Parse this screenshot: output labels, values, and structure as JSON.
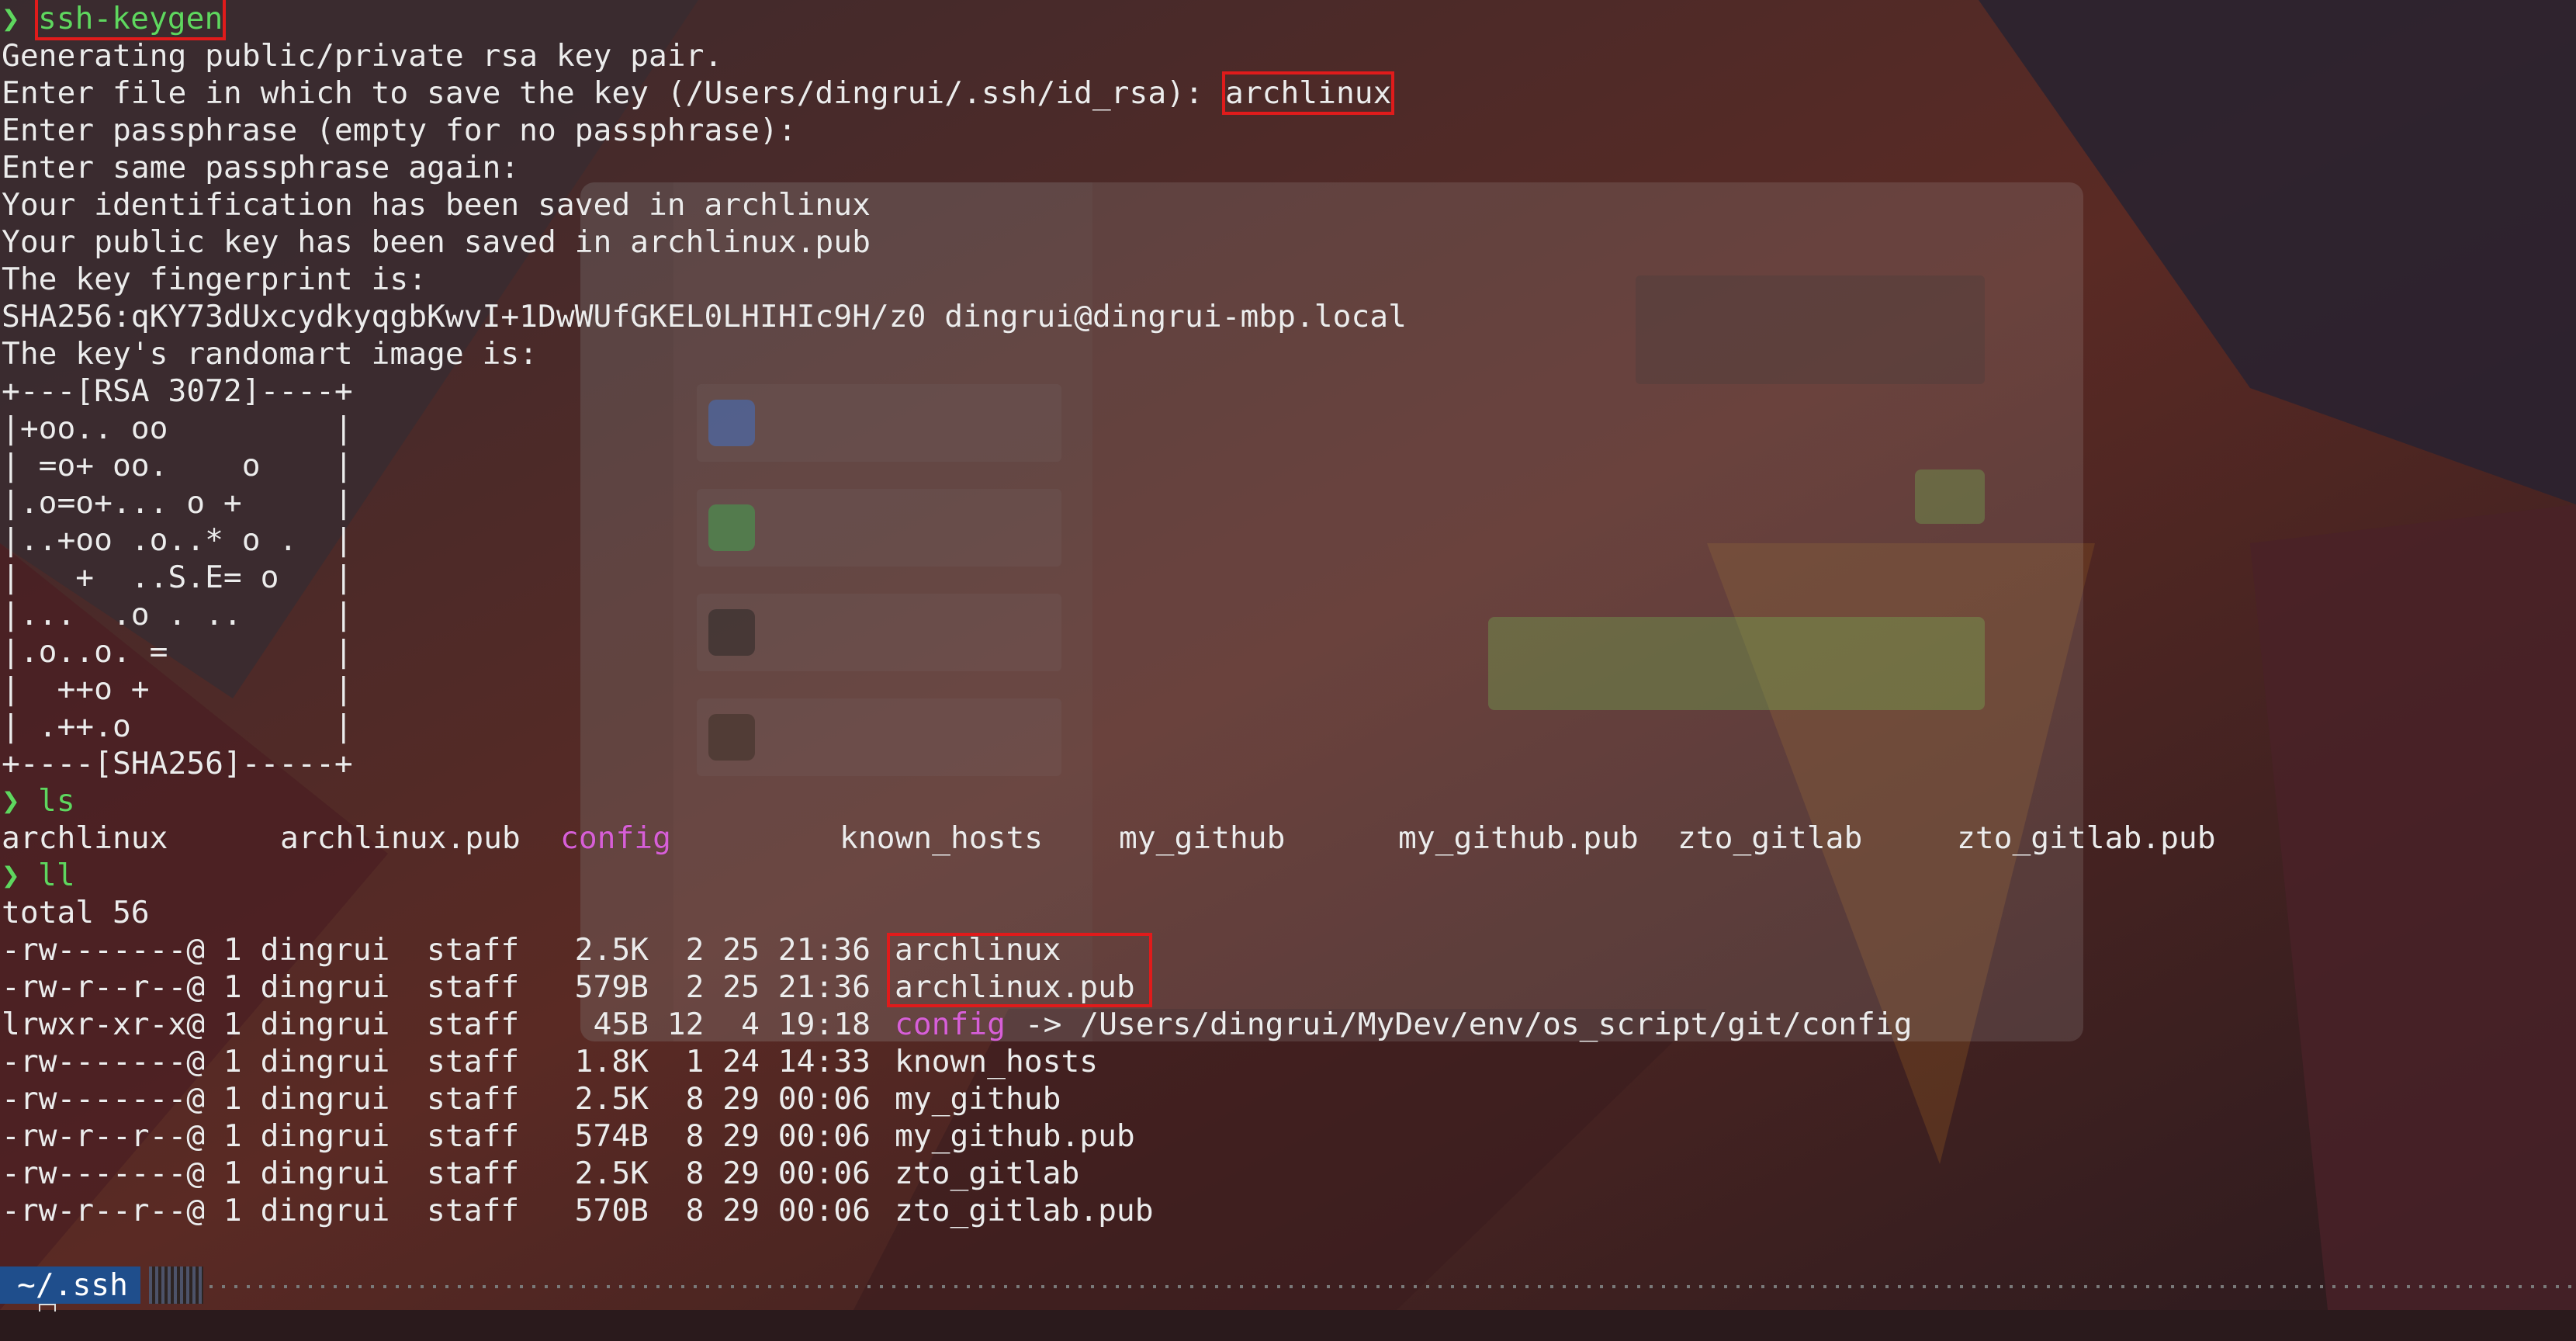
{
  "colors": {
    "prompt": "#5fd75f",
    "symlink": "#d75fd7",
    "highlight_box": "#e01b1b",
    "status_bg": "#1f4e8c",
    "text": "#ececec"
  },
  "prompt_glyph": "❯",
  "keygen": {
    "command": "ssh-keygen",
    "generating": "Generating public/private rsa key pair.",
    "enter_file_prompt": "Enter file in which to save the key (/Users/dingrui/.ssh/id_rsa): ",
    "enter_file_value": "archlinux",
    "passphrase": "Enter passphrase (empty for no passphrase):",
    "passphrase_again": "Enter same passphrase again:",
    "id_saved": "Your identification has been saved in archlinux",
    "pub_saved": "Your public key has been saved in archlinux.pub",
    "fingerprint_label": "The key fingerprint is:",
    "fingerprint": "SHA256:qKY73dUxcydkyqgbKwvI+1DwWUfGKEL0LHIHIc9H/z0 dingrui@dingrui-mbp.local",
    "randomart_label": "The key's randomart image is:",
    "randomart": [
      "+---[RSA 3072]----+",
      "|+oo.. oo         |",
      "| =o+ oo.    o    |",
      "|.o=o+... o +     |",
      "|..+oo .o..* o .  |",
      "|   +  ..S.E= o   |",
      "|...  .o . ..     |",
      "|.o..o. =         |",
      "|  ++o +          |",
      "| .++.o           |",
      "+----[SHA256]-----+"
    ]
  },
  "ls": {
    "command": "ls",
    "files": [
      "archlinux",
      "archlinux.pub",
      "config",
      "known_hosts",
      "my_github",
      "my_github.pub",
      "zto_gitlab",
      "zto_gitlab.pub"
    ]
  },
  "ll": {
    "command": "ll",
    "total": "total 56",
    "rows": [
      {
        "meta": "-rw-------@ 1 dingrui  staff   2.5K  2 25 21:36 ",
        "name": "archlinux"
      },
      {
        "meta": "-rw-r--r--@ 1 dingrui  staff   579B  2 25 21:36 ",
        "name": "archlinux.pub"
      },
      {
        "meta": "lrwxr-xr-x@ 1 dingrui  staff    45B 12  4 19:18 ",
        "name": "config",
        "target": " -> /Users/dingrui/MyDev/env/os_script/git/config"
      },
      {
        "meta": "-rw-------@ 1 dingrui  staff   1.8K  1 24 14:33 ",
        "name": "known_hosts"
      },
      {
        "meta": "-rw-------@ 1 dingrui  staff   2.5K  8 29 00:06 ",
        "name": "my_github"
      },
      {
        "meta": "-rw-r--r--@ 1 dingrui  staff   574B  8 29 00:06 ",
        "name": "my_github.pub"
      },
      {
        "meta": "-rw-------@ 1 dingrui  staff   2.5K  8 29 00:06 ",
        "name": "zto_gitlab"
      },
      {
        "meta": "-rw-r--r--@ 1 dingrui  staff   570B  8 29 00:06 ",
        "name": "zto_gitlab.pub"
      }
    ]
  },
  "status": {
    "cwd": "~/.ssh"
  }
}
